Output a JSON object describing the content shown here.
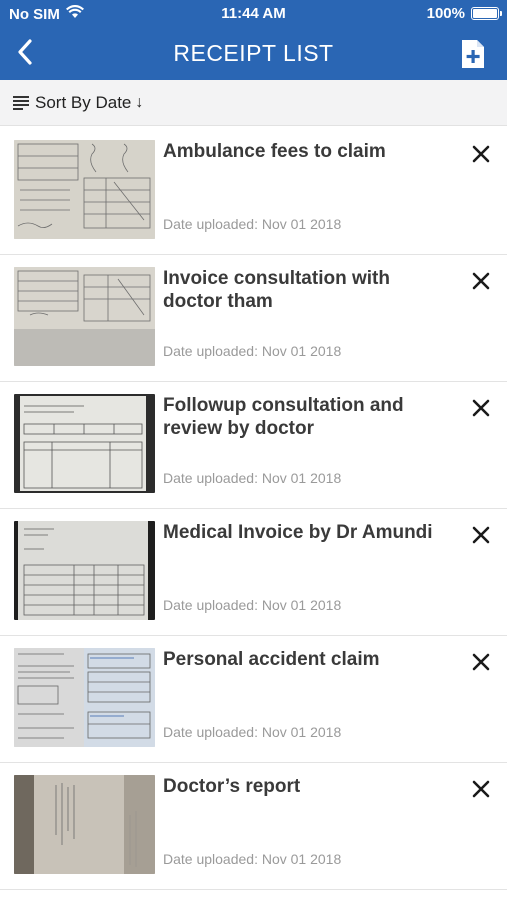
{
  "status_bar": {
    "carrier": "No SIM",
    "time": "11:44 AM",
    "battery": "100%"
  },
  "nav": {
    "title": "RECEIPT LIST",
    "back_icon": "chevron-left-icon",
    "add_icon": "add-document-icon"
  },
  "sort": {
    "label": "Sort By Date",
    "arrow": "↓"
  },
  "receipts": [
    {
      "title": "Ambulance fees to claim",
      "date": "Date uploaded: Nov 01 2018"
    },
    {
      "title": "Invoice consultation with doctor tham",
      "date": "Date uploaded: Nov 01 2018"
    },
    {
      "title": "Followup consultation and review by doctor",
      "date": "Date uploaded: Nov 01 2018"
    },
    {
      "title": "Medical Invoice by Dr Amundi",
      "date": "Date uploaded: Nov 01 2018"
    },
    {
      "title": "Personal accident claim",
      "date": "Date uploaded: Nov 01 2018"
    },
    {
      "title": "Doctor’s report",
      "date": "Date uploaded: Nov 01 2018"
    }
  ],
  "colors": {
    "header": "#2a66b4",
    "sort_bar": "#f3f3f4",
    "title_text": "#3a3a3a",
    "date_text": "#9a9a9a"
  }
}
